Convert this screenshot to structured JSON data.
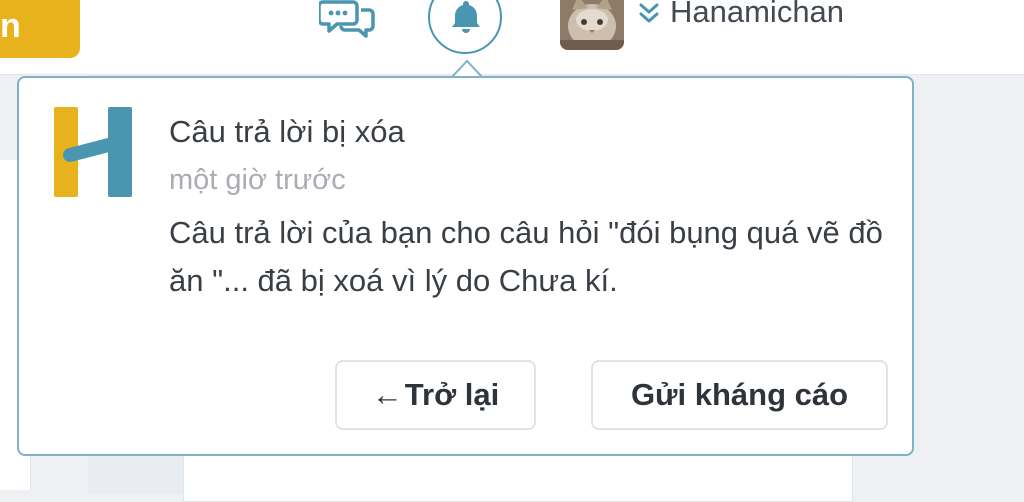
{
  "header": {
    "left_button_text": "n",
    "username": "Hanamichan"
  },
  "notification": {
    "title": "Câu trả lời bị xóa",
    "time": "một giờ trước",
    "body": "Câu trả lời của bạn cho câu hỏi \"đói bụng quá vẽ đồ ăn \"... đã bị xoá vì lý do Chưa kí.",
    "back_arrow": "←",
    "back_label": "Trở lại",
    "appeal_label": "Gửi kháng cáo"
  },
  "colors": {
    "accent_teal": "#4a95b0",
    "accent_yellow": "#e8b21d",
    "popover_border": "#7fb2c4"
  },
  "icons": [
    "chat-bubbles-icon",
    "bell-icon",
    "chevron-double-down-icon",
    "hoc24-logo"
  ]
}
